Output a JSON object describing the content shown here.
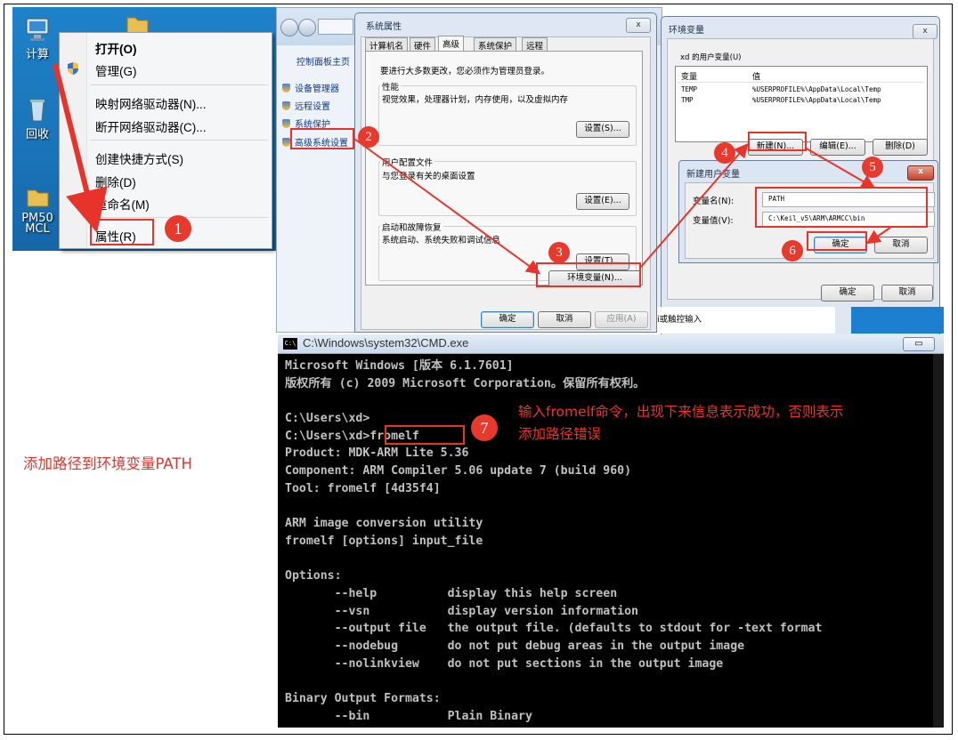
{
  "desktop": {
    "icon_labels": [
      "计算",
      "回收",
      "PM50",
      "MCL"
    ],
    "context_menu": [
      "打开(O)",
      "管理(G)",
      "映射网络驱动器(N)...",
      "断开网络驱动器(C)...",
      "创建快捷方式(S)",
      "删除(D)",
      "重命名(M)",
      "属性(R)"
    ]
  },
  "explorer": {
    "sidebar_home": "控制面板主页",
    "sidebar_links": [
      "设备管理器",
      "远程设置",
      "系统保护",
      "高级系统设置"
    ]
  },
  "sys_props": {
    "title": "系统属性",
    "tabs": [
      "计算机名",
      "硬件",
      "高级",
      "系统保护",
      "远程"
    ],
    "intro": "要进行大多数更改，您必须作为管理员登录。",
    "perf_title": "性能",
    "perf_desc": "视觉效果，处理器计划，内存使用，以及虚拟内存",
    "profile_title": "用户配置文件",
    "profile_desc": "与您登录有关的桌面设置",
    "startup_title": "启动和故障恢复",
    "startup_desc": "系统启动、系统失败和调试信息",
    "settings_s": "设置(S)...",
    "settings_e": "设置(E)...",
    "settings_t": "设置(T)...",
    "env_button": "环境变量(N)...",
    "ok": "确定",
    "cancel": "取消",
    "apply": "应用(A)",
    "close": "x"
  },
  "env_vars": {
    "title": "环境变量",
    "user_vars_label": "xd 的用户变量(U)",
    "col_var": "变量",
    "col_val": "值",
    "rows": [
      {
        "name": "TEMP",
        "value": "%USERPROFILE%\\AppData\\Local\\Temp"
      },
      {
        "name": "TMP",
        "value": "%USERPROFILE%\\AppData\\Local\\Temp"
      }
    ],
    "new": "新建(N)...",
    "edit": "编辑(E)...",
    "delete": "删除(D)",
    "ok": "确定",
    "cancel": "取消",
    "close": "x",
    "behind_text": "i或触控输入"
  },
  "new_var": {
    "title": "新建用户变量",
    "name_label": "变量名(N):",
    "value_label": "变量值(V):",
    "name_value": "PATH",
    "value_value": "C:\\Keil_v5\\ARM\\ARMCC\\bin",
    "ok": "确定",
    "cancel": "取消",
    "close": "x"
  },
  "cmd": {
    "title": "C:\\Windows\\system32\\CMD.exe",
    "lines": [
      "Microsoft Windows [版本 6.1.7601]",
      "版权所有 (c) 2009 Microsoft Corporation。保留所有权利。",
      "",
      "C:\\Users\\xd>",
      "C:\\Users\\xd>fromelf",
      "Product: MDK-ARM Lite 5.36",
      "Component: ARM Compiler 5.06 update 7 (build 960)",
      "Tool: fromelf [4d35f4]",
      "",
      "ARM image conversion utility",
      "fromelf [options] input_file",
      "",
      "Options:",
      "       --help          display this help screen",
      "       --vsn           display version information",
      "       --output file   the output file. (defaults to stdout for -text format",
      "       --nodebug       do not put debug areas in the output image",
      "       --nolinkview    do not put sections in the output image",
      "",
      "Binary Output Formats:",
      "       --bin           Plain Binary"
    ]
  },
  "annotations": {
    "badges": [
      "1",
      "2",
      "3",
      "4",
      "5",
      "6",
      "7"
    ],
    "caption": "添加路径到环境变量PATH",
    "note_line1": "输入fromelf命令，出现下来信息表示成功，否则表示",
    "note_line2": "添加路径错误"
  },
  "colors": {
    "annotation_red": "#e8332b",
    "desktop_blue": "#1a73b8",
    "cmd_bg": "#000000"
  }
}
